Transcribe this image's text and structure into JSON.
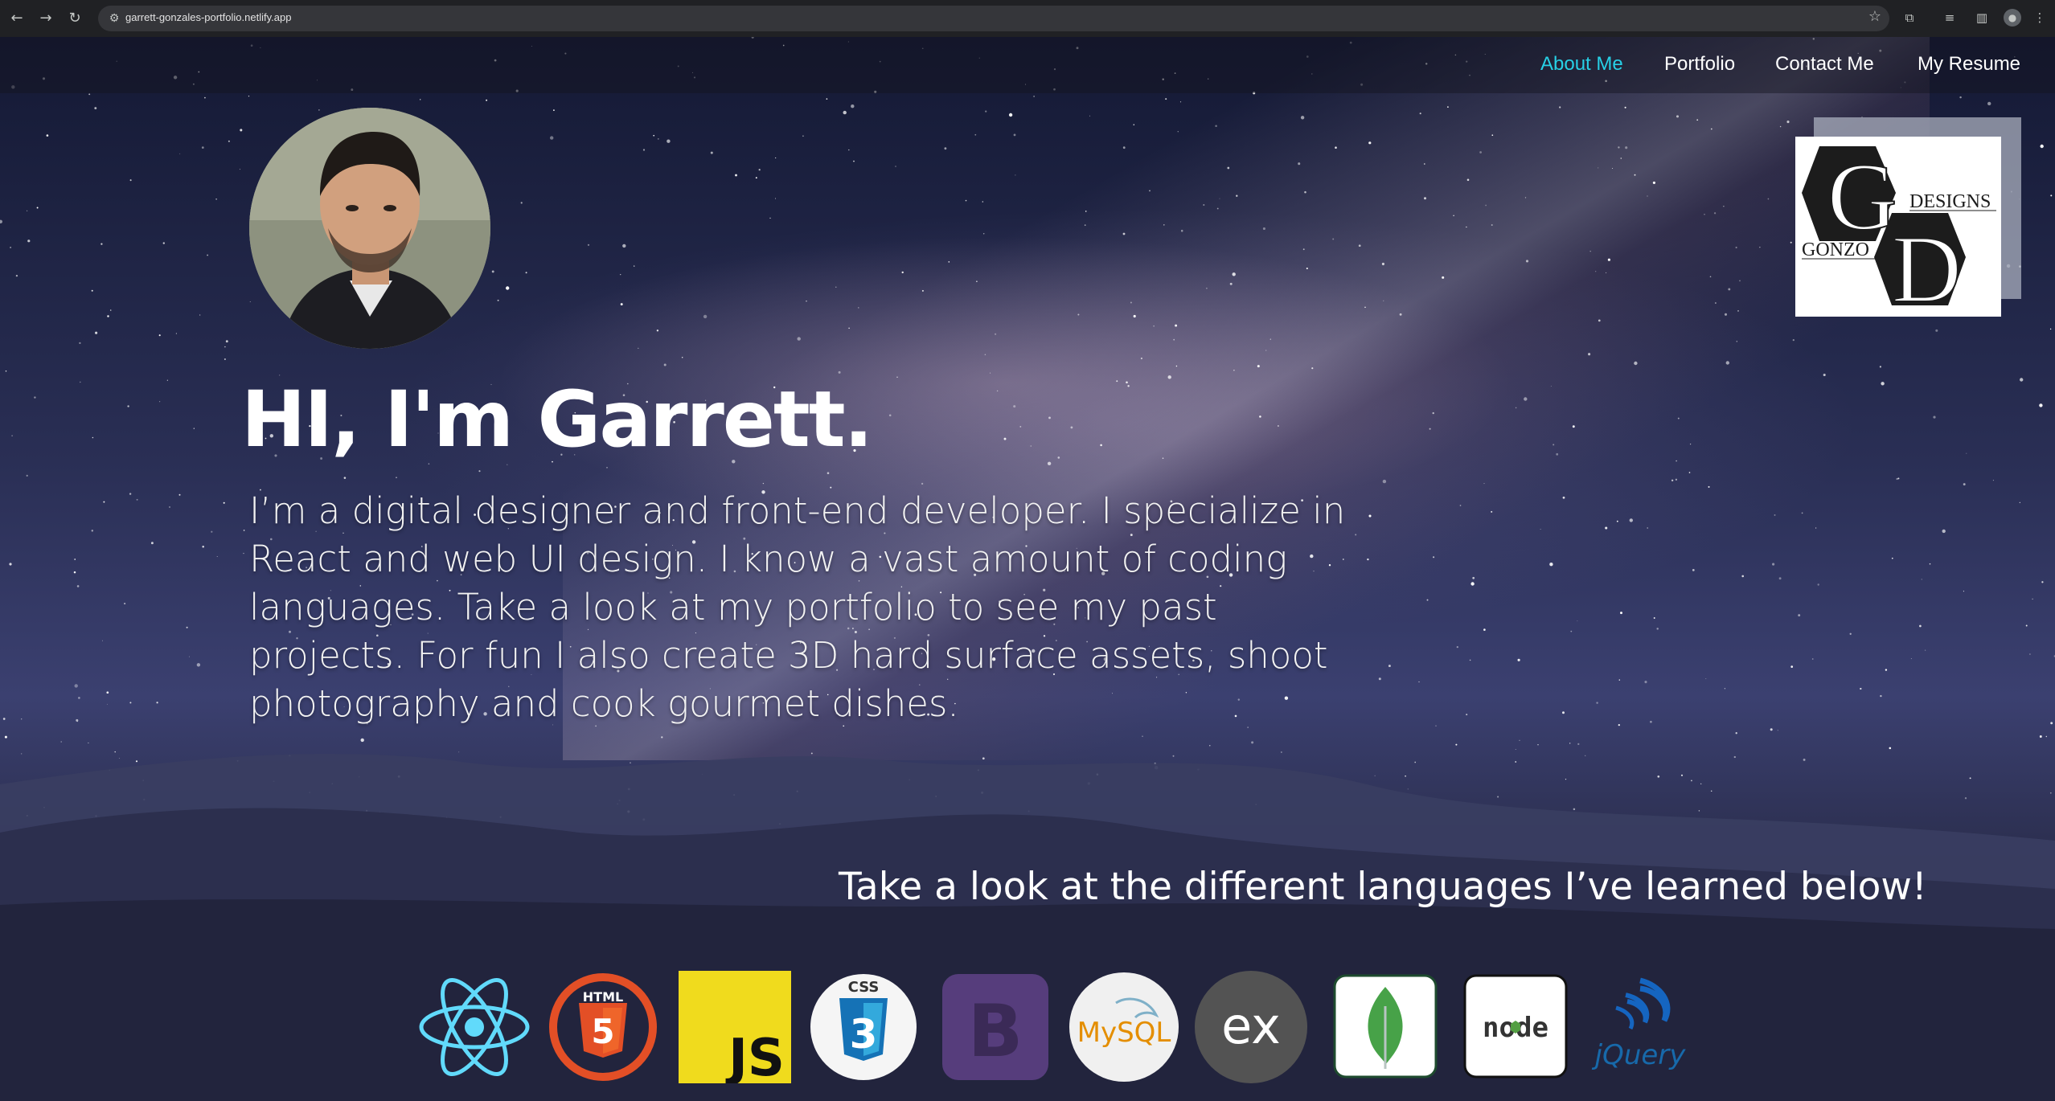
{
  "browser": {
    "url": "garrett-gonzales-portfolio.netlify.app",
    "icons": {
      "back": "arrow-left-icon",
      "forward": "arrow-right-icon",
      "reload": "reload-icon",
      "site_info": "tune-icon",
      "bookmark": "star-icon",
      "extensions": "puzzle-icon",
      "reading_list": "list-icon",
      "side_panel": "side-panel-icon",
      "profile": "profile-icon",
      "menu": "kebab-menu-icon"
    }
  },
  "nav": {
    "items": [
      {
        "label": "About Me",
        "active": true
      },
      {
        "label": "Portfolio",
        "active": false
      },
      {
        "label": "Contact Me",
        "active": false
      },
      {
        "label": "My Resume",
        "active": false
      }
    ],
    "active_color": "#27d0e6"
  },
  "logo": {
    "big_letters": [
      "G",
      "D"
    ],
    "words": [
      "DESIGNS",
      "GONZO"
    ]
  },
  "hero": {
    "title": "HI, I'm Garrett.",
    "description": "I’m a digital designer and front-end developer. I specialize in React and web UI design. I know a vast amount of coding languages. Take a look at my portfolio to see my past projects. For fun I also create 3D hard surface assets, shoot photography and cook gourmet dishes."
  },
  "languages": {
    "heading": "Take a look at the different languages I’ve learned below!",
    "icons": [
      {
        "name": "react-icon",
        "label": ""
      },
      {
        "name": "html5-icon",
        "label": "HTML"
      },
      {
        "name": "javascript-icon",
        "label": "JS"
      },
      {
        "name": "css3-icon",
        "label": "CSS"
      },
      {
        "name": "bootstrap-icon",
        "label": "B"
      },
      {
        "name": "mysql-icon",
        "label": "MySQL"
      },
      {
        "name": "express-icon",
        "label": "ex"
      },
      {
        "name": "mongodb-icon",
        "label": ""
      },
      {
        "name": "nodejs-icon",
        "label": "node"
      },
      {
        "name": "jquery-icon",
        "label": "jQuery"
      }
    ]
  }
}
